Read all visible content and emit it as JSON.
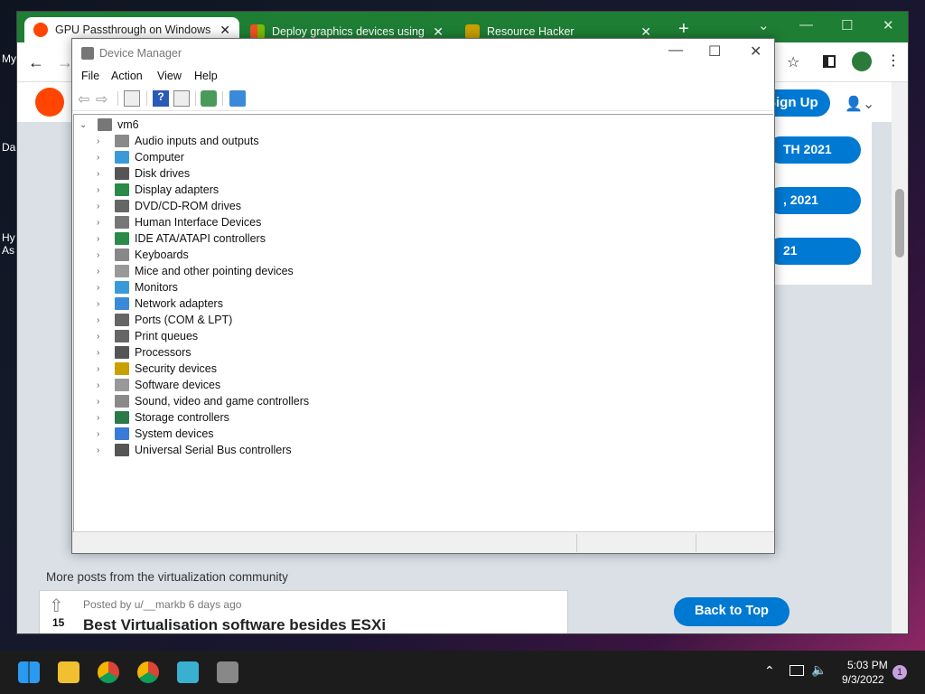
{
  "desktop": {
    "labels": [
      "My",
      "Da",
      "Hy",
      "As"
    ]
  },
  "chrome": {
    "tabs": [
      {
        "title": "GPU Passthrough on Windows H",
        "icon": "reddit-icon",
        "color": "#ff4500"
      },
      {
        "title": "Deploy graphics devices using D",
        "icon": "microsoft-icon",
        "color": "#0078d4"
      },
      {
        "title": "Resource Hacker",
        "icon": "resource-hacker-icon",
        "color": "#c8a000"
      }
    ],
    "new_tab": "+",
    "signup": "Sign Up",
    "sidebar_pills": [
      "TH 2021",
      ", 2021",
      "21"
    ],
    "more_posts": "More posts from the virtualization community",
    "post": {
      "meta": "Posted by u/__markb 6 days ago",
      "score": "15",
      "title": "Best Virtualisation software besides ESXi"
    },
    "back_to_top": "Back to Top"
  },
  "device_manager": {
    "title": "Device Manager",
    "menu": [
      "File",
      "Action",
      "View",
      "Help"
    ],
    "root": "vm6",
    "categories": [
      {
        "label": "Audio inputs and outputs",
        "icon": "speaker-icon",
        "color": "#8a8a8a"
      },
      {
        "label": "Computer",
        "icon": "computer-icon",
        "color": "#3a9ad9"
      },
      {
        "label": "Disk drives",
        "icon": "disk-drive-icon",
        "color": "#555"
      },
      {
        "label": "Display adapters",
        "icon": "display-adapter-icon",
        "color": "#2a8a4a"
      },
      {
        "label": "DVD/CD-ROM drives",
        "icon": "dvd-drive-icon",
        "color": "#666"
      },
      {
        "label": "Human Interface Devices",
        "icon": "hid-icon",
        "color": "#777"
      },
      {
        "label": "IDE ATA/ATAPI controllers",
        "icon": "ide-controller-icon",
        "color": "#2a8a4a"
      },
      {
        "label": "Keyboards",
        "icon": "keyboard-icon",
        "color": "#888"
      },
      {
        "label": "Mice and other pointing devices",
        "icon": "mouse-icon",
        "color": "#999"
      },
      {
        "label": "Monitors",
        "icon": "monitor-icon",
        "color": "#3a9ad9"
      },
      {
        "label": "Network adapters",
        "icon": "network-adapter-icon",
        "color": "#3a8ad9"
      },
      {
        "label": "Ports (COM & LPT)",
        "icon": "port-icon",
        "color": "#666"
      },
      {
        "label": "Print queues",
        "icon": "printer-icon",
        "color": "#666"
      },
      {
        "label": "Processors",
        "icon": "processor-icon",
        "color": "#555"
      },
      {
        "label": "Security devices",
        "icon": "security-device-icon",
        "color": "#c8a000"
      },
      {
        "label": "Software devices",
        "icon": "software-device-icon",
        "color": "#999"
      },
      {
        "label": "Sound, video and game controllers",
        "icon": "speaker-icon",
        "color": "#8a8a8a"
      },
      {
        "label": "Storage controllers",
        "icon": "storage-controller-icon",
        "color": "#2a7a4a"
      },
      {
        "label": "System devices",
        "icon": "system-device-icon",
        "color": "#3a7ad9"
      },
      {
        "label": "Universal Serial Bus controllers",
        "icon": "usb-icon",
        "color": "#555"
      }
    ]
  },
  "taskbar": {
    "time": "5:03 PM",
    "date": "9/3/2022",
    "notification_count": "1"
  }
}
